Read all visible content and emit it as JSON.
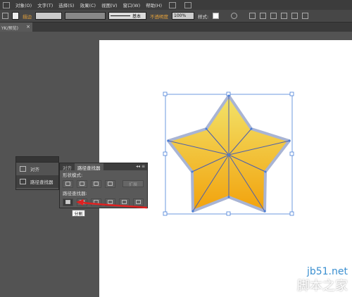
{
  "menubar": {
    "items": [
      "对象(O)",
      "文字(T)",
      "选择(S)",
      "效果(C)",
      "视图(V)",
      "窗口(W)",
      "帮助(H)"
    ]
  },
  "control_bar": {
    "left_label": "描边",
    "stroke_style": "基本",
    "opacity_label": "不透明度",
    "opacity_value": "100%",
    "style_label": "样式:"
  },
  "doc_tab": {
    "title": "YK/预览)",
    "close": "×"
  },
  "align_panel": {
    "items": [
      {
        "label": "对齐",
        "icon": "align-icon"
      },
      {
        "label": "路径查找器",
        "icon": "pathfinder-icon"
      }
    ]
  },
  "pathfinder_panel": {
    "tabs": [
      "对齐",
      "路径查找器"
    ],
    "controls": "◂◂ ≡",
    "shape_modes_label": "形状模式:",
    "expand_label": "扩展",
    "pathfinders_label": "路径查找器:",
    "tooltip": "分割"
  },
  "watermark": {
    "site": "jb51.net",
    "name": "脚本之家"
  },
  "colors": {
    "star_top": "#f2e36a",
    "star_bottom": "#f2a20c",
    "selection": "#4a7fd8",
    "arrow": "#e02020"
  }
}
